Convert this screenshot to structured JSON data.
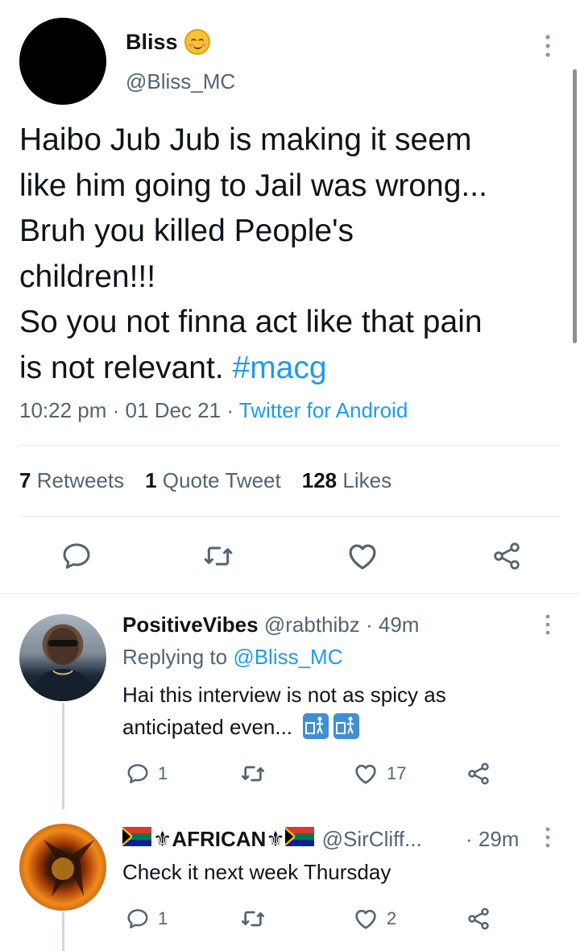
{
  "tweet": {
    "author_name": "Bliss",
    "author_emoji": "smiling-face-emoji",
    "handle": "@Bliss_MC",
    "text_lines": [
      "Haibo Jub Jub is making it seem",
      "like him going to Jail was wrong...",
      "Bruh you killed People's",
      "children!!!",
      "So you not finna act like that pain"
    ],
    "text_last_prefix": "is not relevant. ",
    "hashtag": "#macg",
    "time": "10:22 pm",
    "date": "01 Dec 21",
    "source": "Twitter for Android",
    "meta_sep": "·",
    "stats": {
      "retweets_count": "7",
      "retweets_label": "Retweets",
      "quotes_count": "1",
      "quotes_label": "Quote Tweet",
      "likes_count": "128",
      "likes_label": "Likes"
    }
  },
  "replies": [
    {
      "name": "PositiveVibes",
      "handle": "@rabthibz",
      "time": "· 49m",
      "replying_prefix": "Replying to",
      "replying_to": "@Bliss_MC",
      "text_line1": "Hai this interview is not as spicy as",
      "text_line2": "anticipated even...",
      "reply_count": "1",
      "like_count": "17"
    },
    {
      "name": "AFRICAN",
      "handle": "@SirCliff...",
      "time": "· 29m",
      "text_line1": "Check it next week Thursday",
      "reply_count": "1",
      "like_count": "2"
    }
  ],
  "colors": {
    "accent": "#1d9bf0",
    "secondary_text": "#536471",
    "primary_text": "#0f1419"
  }
}
